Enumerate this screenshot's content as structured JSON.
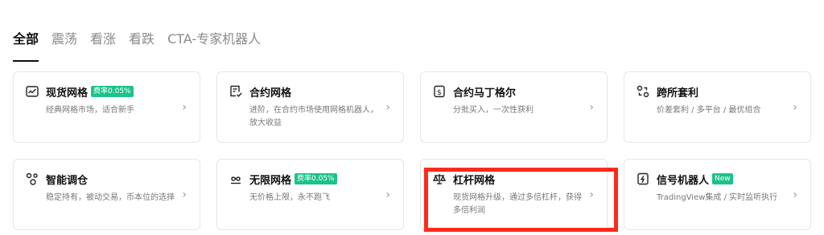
{
  "tabs": [
    "全部",
    "震荡",
    "看涨",
    "看跌",
    "CTA-专家机器人"
  ],
  "cards": [
    {
      "title": "现货网格",
      "badge": "费率0.05%",
      "desc": "经典网格市场，适合新手",
      "icon": "spot-grid-icon"
    },
    {
      "title": "合约网格",
      "badge": "",
      "desc": "进阶，在合约市场使用网格机器人，放大收益",
      "icon": "contract-grid-icon"
    },
    {
      "title": "合约马丁格尔",
      "badge": "",
      "desc": "分批买入，一次性获利",
      "icon": "martingale-icon"
    },
    {
      "title": "跨所套利",
      "badge": "",
      "desc": "价差套利 / 多平台 / 最优组合",
      "icon": "arbitrage-icon"
    },
    {
      "title": "智能调仓",
      "badge": "",
      "desc": "稳定持有，被动交易，币本位的选择",
      "icon": "rebalance-icon"
    },
    {
      "title": "无限网格",
      "badge": "费率0.05%",
      "desc": "无价格上限，永不跑飞",
      "icon": "infinity-icon"
    },
    {
      "title": "杠杆网格",
      "badge": "",
      "desc": "现货网格升级，通过多倍杠杆，获得多倍利润",
      "icon": "leverage-grid-icon"
    },
    {
      "title": "信号机器人",
      "badge": "New",
      "desc": "TradingView集成 / 实时监听执行",
      "icon": "signal-bot-icon"
    }
  ],
  "chevron": "›",
  "colors": {
    "badge": "#1cc28b",
    "highlight": "#ff2a1a"
  }
}
